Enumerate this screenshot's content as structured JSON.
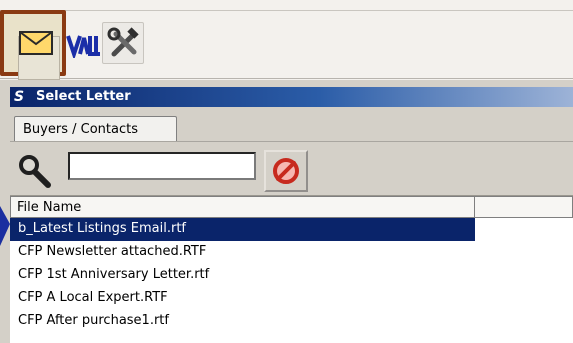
{
  "window": {
    "title": "Select Letter",
    "title_logo": "S"
  },
  "tabs": [
    {
      "label": "Buyers / Contacts",
      "active": true
    }
  ],
  "search": {
    "value": "",
    "placeholder": ""
  },
  "table": {
    "columns": [
      "File Name",
      ""
    ],
    "rows": [
      {
        "file": "b_Latest Listings Email.rtf",
        "selected": true
      },
      {
        "file": "CFP  Newsletter attached.RTF",
        "selected": false
      },
      {
        "file": "CFP 1st  Anniversary Letter.rtf",
        "selected": false
      },
      {
        "file": "CFP A Local Expert.RTF",
        "selected": false
      },
      {
        "file": "CFP After purchase1.rtf",
        "selected": false
      }
    ]
  },
  "icons": {
    "mail": "envelope-icon",
    "vall": "vall-icon",
    "tools": "hammer-wrench-icon",
    "search": "magnifier-icon",
    "clear": "prohibition-icon"
  },
  "colors": {
    "selection": "#0a246a",
    "titlebar_start": "#0a246a",
    "titlebar_end": "#9db3d7",
    "active_button_border": "#8a3a12",
    "window_bg": "#d4d0c8"
  }
}
